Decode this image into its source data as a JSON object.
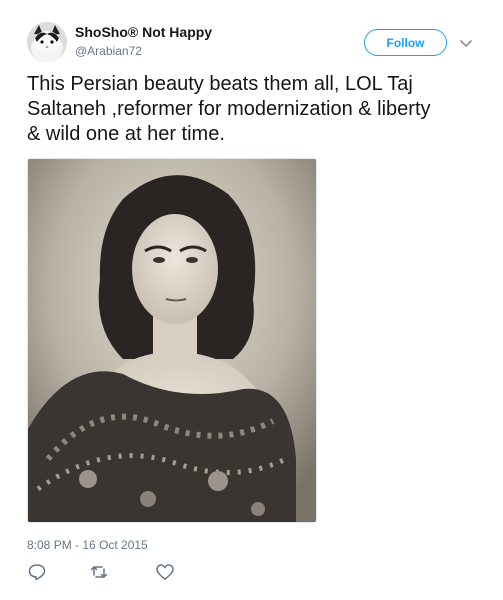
{
  "user": {
    "name": "ShoSho® Not Happy",
    "handle": "@Arabian72"
  },
  "follow": {
    "label": "Follow"
  },
  "tweet": {
    "line1": "This Persian beauty beats them all, LOL Taj",
    "line2": "Saltaneh ,reformer for modernization & liberty",
    "line3": "& wild one at her time.",
    "timestamp": "8:08 PM - 16 Oct 2015"
  },
  "icons": {
    "avatar": "cat-avatar",
    "caret": "chevron-down-icon",
    "reply": "reply-icon",
    "retweet": "retweet-icon",
    "like": "heart-icon"
  },
  "colors": {
    "accent": "#1da1f2",
    "text": "#14171a",
    "secondary": "#657786",
    "border": "#e1e8ed"
  }
}
